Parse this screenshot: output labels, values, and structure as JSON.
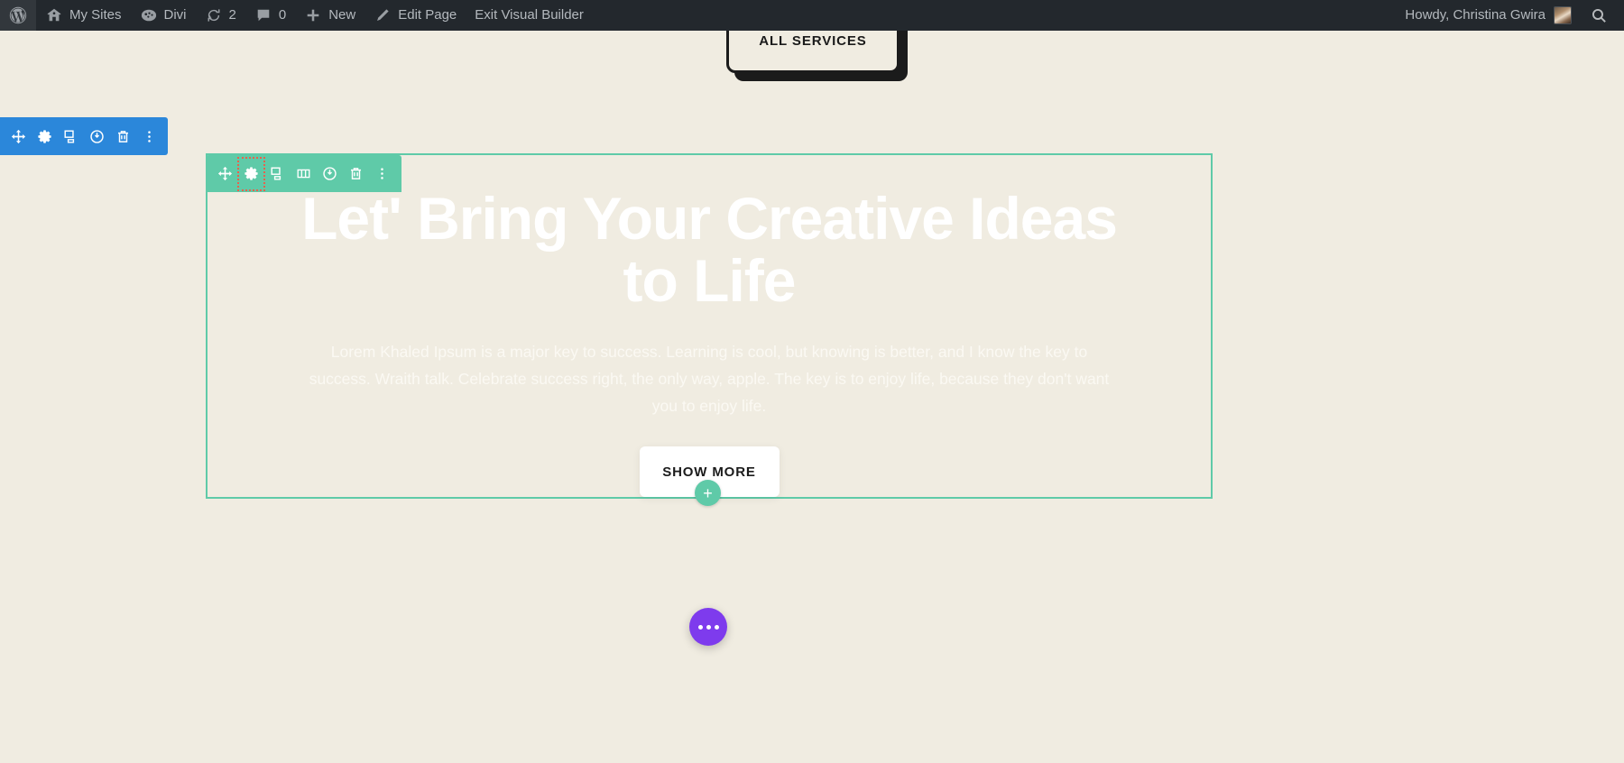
{
  "adminbar": {
    "left_items": [
      {
        "name": "wp-logo",
        "label": "",
        "icon": "wordpress-icon"
      },
      {
        "name": "my-sites",
        "label": "My Sites",
        "icon": "sites-icon"
      },
      {
        "name": "divi",
        "label": "Divi",
        "icon": "divi-icon"
      },
      {
        "name": "updates",
        "label": "2",
        "icon": "update-icon"
      },
      {
        "name": "comments",
        "label": "0",
        "icon": "comment-icon"
      },
      {
        "name": "new-content",
        "label": "New",
        "icon": "plus-icon"
      },
      {
        "name": "edit-page",
        "label": "Edit Page",
        "icon": "pencil-icon"
      },
      {
        "name": "exit-visual-builder",
        "label": "Exit Visual Builder",
        "icon": ""
      }
    ],
    "howdy": "Howdy, Christina Gwira",
    "search_icon": "search-icon",
    "background": "#23282d",
    "text_color": "#b4b9be"
  },
  "page": {
    "background": "#f0ece1"
  },
  "all_services": {
    "label": "ALL SERVICES"
  },
  "section_toolbar": {
    "color": "#2b87da",
    "buttons": [
      {
        "name": "move-section-handle",
        "icon": "move-icon"
      },
      {
        "name": "section-settings-button",
        "icon": "gear-icon"
      },
      {
        "name": "duplicate-section-button",
        "icon": "duplicate-icon"
      },
      {
        "name": "disable-section-button",
        "icon": "power-icon"
      },
      {
        "name": "delete-section-button",
        "icon": "trash-icon"
      },
      {
        "name": "section-more-options-button",
        "icon": "kebab-menu-icon"
      }
    ]
  },
  "row_toolbar": {
    "color": "#5fcaa8",
    "selection_outline": "#e8614d",
    "buttons": [
      {
        "name": "move-row-handle",
        "icon": "move-icon"
      },
      {
        "name": "row-settings-button",
        "icon": "gear-icon"
      },
      {
        "name": "duplicate-row-button",
        "icon": "duplicate-icon"
      },
      {
        "name": "row-columns-button",
        "icon": "columns-icon"
      },
      {
        "name": "disable-row-button",
        "icon": "power-icon"
      },
      {
        "name": "delete-row-button",
        "icon": "trash-icon"
      },
      {
        "name": "row-more-options-button",
        "icon": "kebab-menu-icon"
      }
    ]
  },
  "hero": {
    "title": "Let' Bring Your Creative Ideas to Life",
    "subtitle": "Lorem Khaled Ipsum is a major key to success. Learning is cool, but knowing is better, and I know the key to success. Wraith talk. Celebrate success right, the only way, apple. The key is to enjoy life, because they don't want you to enjoy life.",
    "button_label": "SHOW MORE",
    "row_outline_color": "#5fcaa8",
    "text_color": "#ffffff"
  },
  "add_row": {
    "label": "+",
    "color": "#5fcaa8"
  },
  "fab": {
    "name": "builder-menu-button",
    "color": "#7e3bed",
    "icon": "ellipsis-icon"
  }
}
